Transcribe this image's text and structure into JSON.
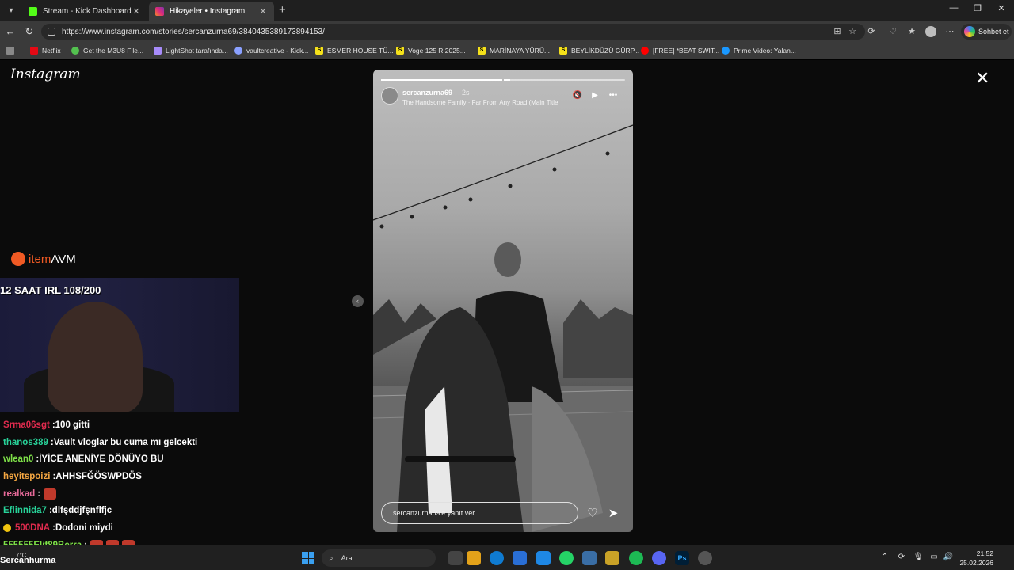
{
  "browser": {
    "tabs": [
      {
        "title": "Stream - Kick Dashboard",
        "icon": "kick-icon",
        "color": "#53fc18"
      },
      {
        "title": "Hikayeler • Instagram",
        "icon": "instagram-icon",
        "color": "#e1306c"
      }
    ],
    "new_tab": "+",
    "url": "https://www.instagram.com/stories/sercanzurna69/3840435389173894153/",
    "copilot_label": "Sohbet et",
    "bookmarks": [
      {
        "label": "Netflix",
        "icon": "netflix-icon",
        "color": "#e50914"
      },
      {
        "label": "Get the M3U8 File...",
        "icon": "globe-icon",
        "color": "#53c14f"
      },
      {
        "label": "LightShot tarafında...",
        "icon": "feather-icon",
        "color": "#a78bfa"
      },
      {
        "label": "vaultcreative - Kick...",
        "icon": "vault-icon",
        "color": "#8aa0ff"
      },
      {
        "label": "ESMER HOUSE TÜ...",
        "icon": "s-icon",
        "color": "#f5e11a"
      },
      {
        "label": "Voge 125 R 2025...",
        "icon": "s-icon",
        "color": "#f5e11a"
      },
      {
        "label": "MARİNAYA YÜRÜ...",
        "icon": "s-icon",
        "color": "#f5e11a"
      },
      {
        "label": "BEYLİKDÜZÜ GÜRP...",
        "icon": "s-icon",
        "color": "#f5e11a"
      },
      {
        "label": "[FREE] *BEAT SWIT...",
        "icon": "youtube-icon",
        "color": "#ff0000"
      },
      {
        "label": "Prime Video: Yalan...",
        "icon": "prime-icon",
        "color": "#1a98ff"
      }
    ]
  },
  "instagram": {
    "logo": "Instagram",
    "close": "✕",
    "story": {
      "username": "sercanzurna69",
      "time": "2s",
      "music": "The Handsome Family · Far From Any Road (Main Title",
      "reply_placeholder": "sercanzurna69'e yanıt ver...",
      "progress": [
        1.0,
        0.05
      ]
    }
  },
  "stream": {
    "sponsor_a": "item",
    "sponsor_b": "AVM",
    "title": "12 SAAT IRL 108/200",
    "chat": [
      {
        "user": "Srma06sgt",
        "color": "#e02b4e",
        "message": "100 gitti"
      },
      {
        "user": "thanos389",
        "color": "#28d39a",
        "message": "Vault vloglar bu cuma mı gelcekti"
      },
      {
        "user": "wlean0",
        "color": "#7ee048",
        "message": "İYİCE ANENİYE DÖNÜYO BU"
      },
      {
        "user": "heyitspoizi",
        "color": "#f5a742",
        "message": "AHHSFĞÖSWPDÖS"
      },
      {
        "user": "realkad",
        "color": "#e86a9a",
        "message": "",
        "emotes": 1
      },
      {
        "user": "Eflinnida7",
        "color": "#28d39a",
        "message": "dlfşddjfşnflfjc"
      },
      {
        "user": "500DNA",
        "color": "#e02b4e",
        "message": "Dodoni miydi",
        "coin": true
      },
      {
        "user": "555555Elif89Berra",
        "color": "#7ee048",
        "message": "",
        "emotes": 3
      }
    ]
  },
  "taskbar": {
    "weather": "7°C",
    "viewer_line": "Sercanhurma",
    "search_placeholder": "Ara",
    "time": "21:52",
    "date": "25.02.2026"
  }
}
